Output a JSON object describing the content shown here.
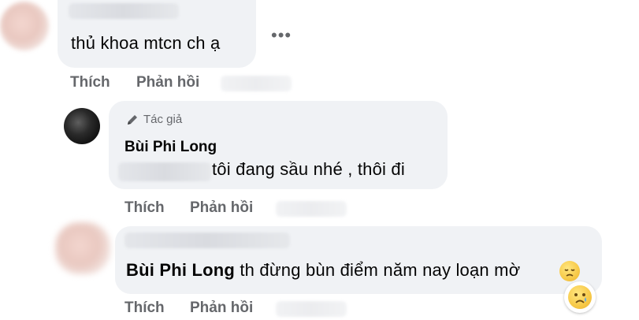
{
  "comment1": {
    "text": "thủ khoa mtcn ch ạ",
    "more_label": "•••"
  },
  "reply1": {
    "author_badge": "Tác giả",
    "author_name": "Bùi Phi Long",
    "text": "tôi đang sầu nhé , thôi đi"
  },
  "reply2": {
    "mention": "Bùi Phi Long",
    "text": " th đừng bùn điểm năm nay loạn mờ"
  },
  "actions": {
    "like": "Thích",
    "reply": "Phản hồi"
  },
  "icons": {
    "more": "more-options-icon",
    "pencil": "pencil-icon",
    "emoji_sad": "disappointed-face-icon",
    "emoji_cry": "crying-face-icon"
  }
}
